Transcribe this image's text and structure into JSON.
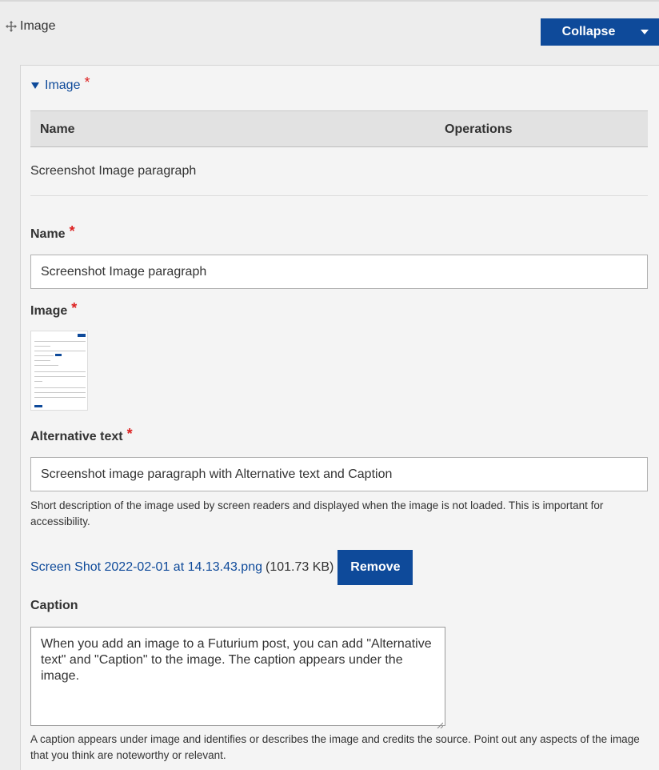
{
  "header": {
    "drag_icon": "move-arrows-icon",
    "title": "Image",
    "collapse_label": "Collapse"
  },
  "panel": {
    "summary_label": "Image",
    "required_mark": "*",
    "table": {
      "columns": [
        "Name",
        "Operations"
      ],
      "rows": [
        [
          "Screenshot Image paragraph",
          ""
        ]
      ]
    },
    "name_field": {
      "label": "Name",
      "value": "Screenshot Image paragraph"
    },
    "image_field": {
      "label": "Image"
    },
    "alt_field": {
      "label": "Alternative text",
      "value": "Screenshot image paragraph with Alternative text and Caption",
      "description": "Short description of the image used by screen readers and displayed when the image is not loaded. This is important for accessibility."
    },
    "file": {
      "name": "Screen Shot 2022-02-01 at 14.13.43.png",
      "size": "(101.73 KB)",
      "remove_label": "Remove"
    },
    "caption_field": {
      "label": "Caption",
      "value": "When you add an image to a Futurium post, you can add \"Alternative text\" and \"Caption\" to the image. The caption appears under the image.",
      "description": "A caption appears under image and identifies or describes the image and credits the source. Point out any aspects of the image that you think are noteworthy or relevant."
    }
  },
  "colors": {
    "accent": "#0e4a9a",
    "required": "#dd2222",
    "background": "#ededed"
  }
}
